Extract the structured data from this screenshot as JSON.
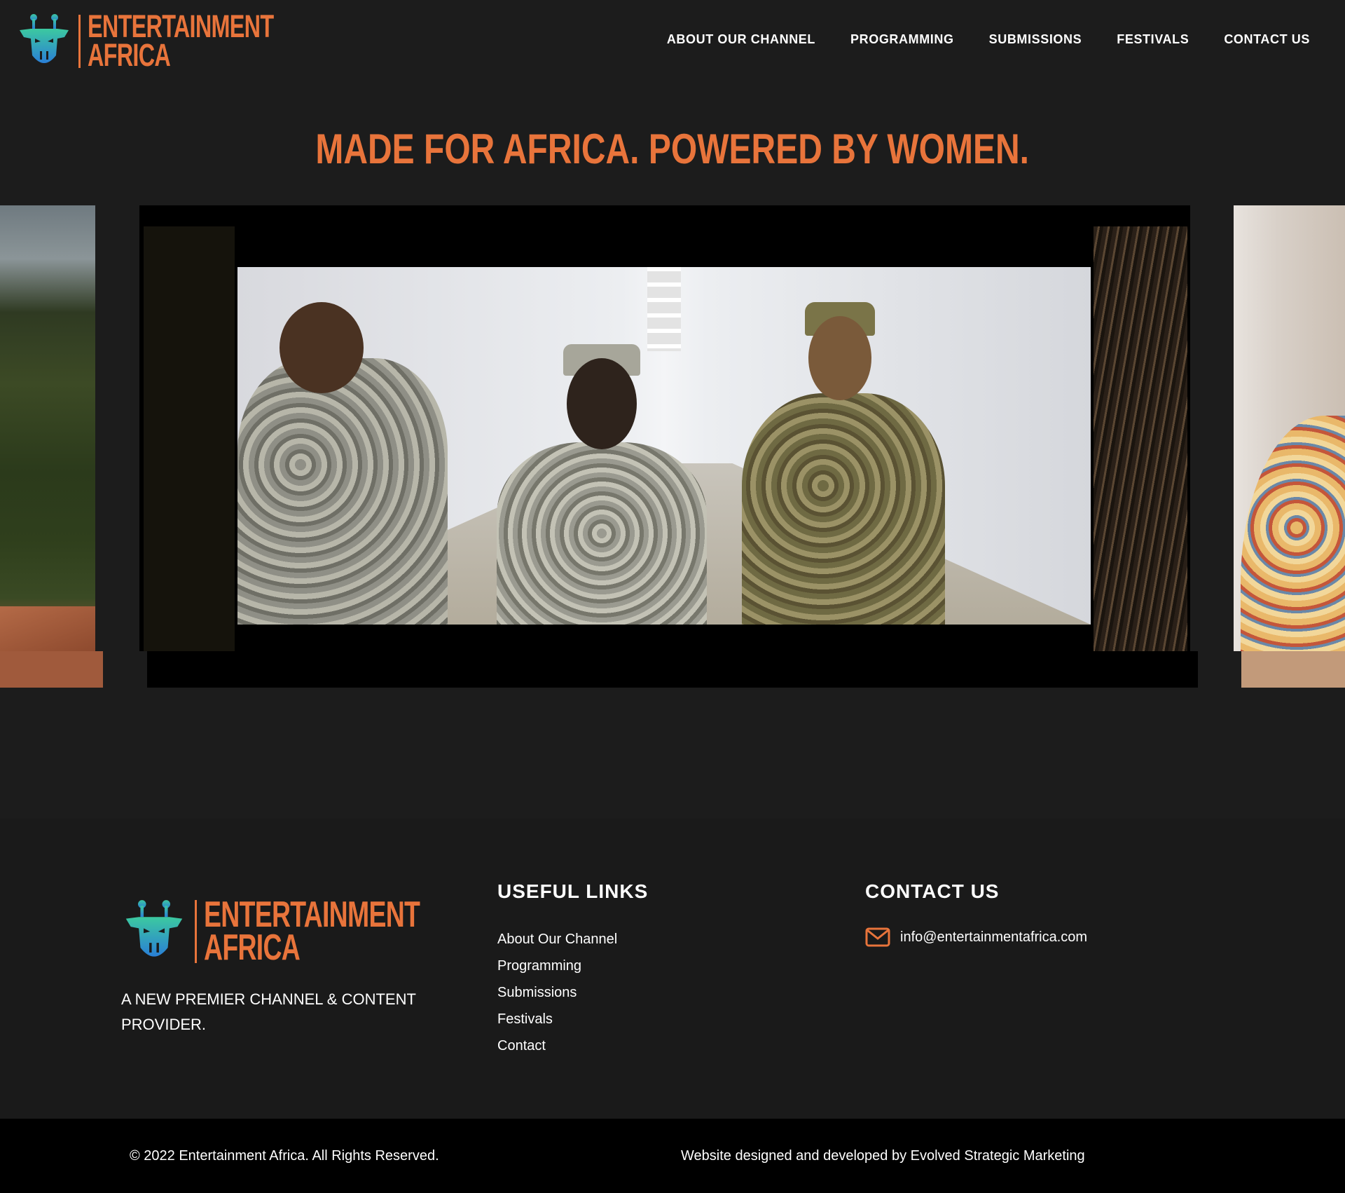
{
  "brand": {
    "line1": "ENTERTAINMENT",
    "line2": "AFRICA",
    "accent_color": "#e8743b",
    "icon": "giraffe-logo-icon"
  },
  "nav": {
    "items": [
      {
        "label": "ABOUT OUR CHANNEL"
      },
      {
        "label": "PROGRAMMING"
      },
      {
        "label": "SUBMISSIONS"
      },
      {
        "label": "FESTIVALS"
      },
      {
        "label": "CONTACT US"
      }
    ]
  },
  "hero": {
    "headline": "MADE FOR AFRICA. POWERED BY WOMEN."
  },
  "footer": {
    "tagline": "A NEW PREMIER CHANNEL & CONTENT PROVIDER.",
    "useful_links": {
      "title": "USEFUL LINKS",
      "items": [
        {
          "label": "About Our Channel"
        },
        {
          "label": "Programming"
        },
        {
          "label": "Submissions"
        },
        {
          "label": "Festivals"
        },
        {
          "label": "Contact"
        }
      ]
    },
    "contact": {
      "title": "CONTACT US",
      "email": "info@entertainmentafrica.com",
      "icon": "envelope-icon"
    }
  },
  "bottom_bar": {
    "copyright": "© 2022 Entertainment Africa. All Rights Reserved.",
    "credit": "Website designed and developed by Evolved Strategic Marketing"
  }
}
